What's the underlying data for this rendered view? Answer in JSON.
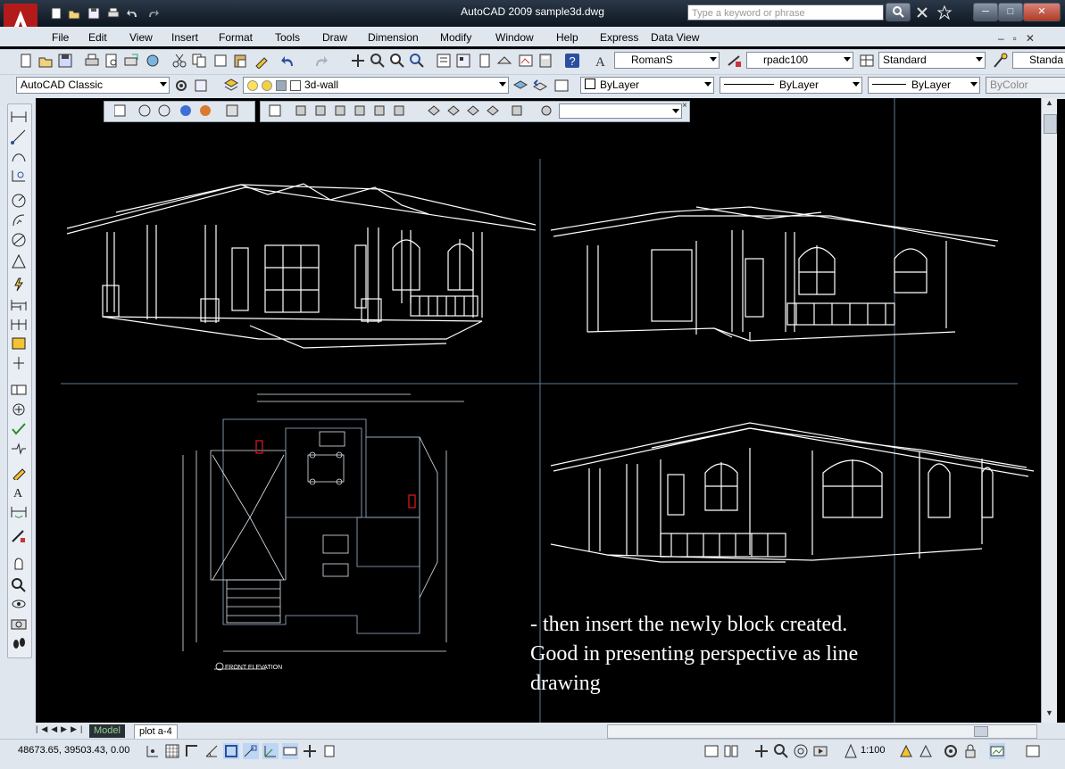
{
  "window": {
    "title": "AutoCAD 2009  sample3d.dwg",
    "search_placeholder": "Type a keyword or phrase"
  },
  "menu": [
    "File",
    "Edit",
    "View",
    "Insert",
    "Format",
    "Tools",
    "Draw",
    "Dimension",
    "Modify",
    "Window",
    "Help",
    "Express",
    "Data View"
  ],
  "toolbar": {
    "text_style": "RomanS",
    "dim_style": "rpadc100",
    "table_style": "Standard",
    "multileader_style": "Standa",
    "workspace": "AutoCAD Classic",
    "layer": "3d-wall",
    "color": "ByLayer",
    "linetype": "ByLayer",
    "lineweight": "ByLayer",
    "plot_style": "ByColor"
  },
  "canvas": {
    "floor_plan_label": "FRONT ELEVATION",
    "caption": "- then insert the newly block created.\nGood in presenting perspective as line\ndrawing"
  },
  "layout_tabs": [
    "Model",
    "plot a-4"
  ],
  "status": {
    "coordinates": "48673.65, 39503.43, 0.00",
    "annotation_scale": "1:100"
  },
  "colors": {
    "title_bg": "#1b2533",
    "ui_bg": "#dfe6ee",
    "canvas_bg": "#000000",
    "line_color": "#ffffff",
    "viewport_border": "#5b7a99",
    "accent_red": "#e21a1a"
  }
}
